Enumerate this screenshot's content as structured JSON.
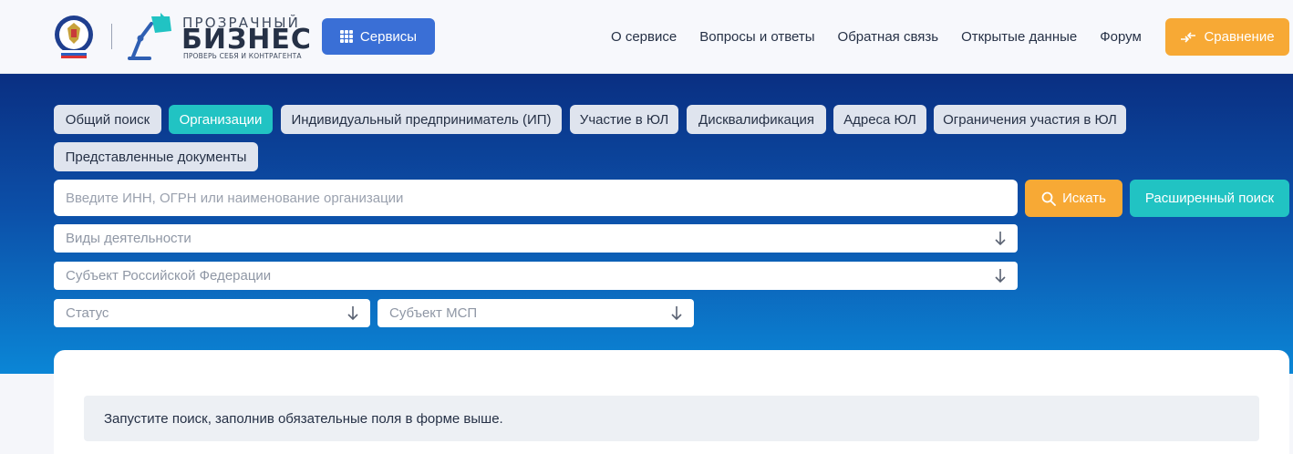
{
  "header": {
    "brand_small": "ПРОЗРАЧНЫЙ",
    "brand_big": "БИЗНЕС",
    "brand_tag": "ПРОВЕРЬ СЕБЯ И КОНТРАГЕНТА",
    "services_label": "Сервисы",
    "nav": [
      "О сервисе",
      "Вопросы и ответы",
      "Обратная связь",
      "Открытые данные",
      "Форум"
    ],
    "compare_label": "Сравнение"
  },
  "tabs": [
    {
      "label": "Общий поиск",
      "active": false
    },
    {
      "label": "Организации",
      "active": true
    },
    {
      "label": "Индивидуальный предприниматель (ИП)",
      "active": false
    },
    {
      "label": "Участие в ЮЛ",
      "active": false
    },
    {
      "label": "Дисквалификация",
      "active": false
    },
    {
      "label": "Адреса ЮЛ",
      "active": false
    },
    {
      "label": "Ограничения участия в ЮЛ",
      "active": false
    },
    {
      "label": "Представленные документы",
      "active": false
    }
  ],
  "search": {
    "placeholder": "Введите ИНН, ОГРН или наименование организации",
    "search_label": "Искать",
    "advanced_label": "Расширенный поиск"
  },
  "filters": {
    "activity": "Виды деятельности",
    "region": "Субъект Российской Федерации",
    "status": "Статус",
    "msp": "Субъект МСП"
  },
  "notice": "Запустите поиск, заполнив обязательные поля в форме выше.",
  "colors": {
    "accent_blue": "#3a6fd6",
    "accent_orange": "#f7a935",
    "accent_teal": "#21c3c3",
    "hero_top": "#0a2f82",
    "hero_bottom": "#0b86d6"
  }
}
